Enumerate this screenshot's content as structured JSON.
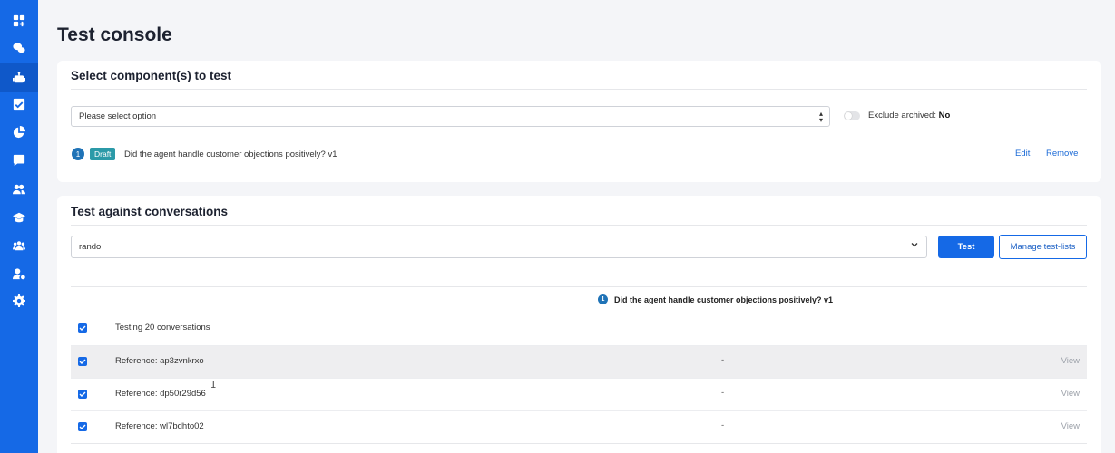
{
  "page": {
    "title": "Test console"
  },
  "sidebar": {
    "items": [
      {
        "icon": "dashboard-add-icon"
      },
      {
        "icon": "chat-bubbles-icon"
      },
      {
        "icon": "robot-icon",
        "active": true
      },
      {
        "icon": "checkbox-icon"
      },
      {
        "icon": "pie-chart-icon"
      },
      {
        "icon": "message-icon"
      },
      {
        "icon": "users-icon"
      },
      {
        "icon": "graduation-cap-icon"
      },
      {
        "icon": "team-icon"
      },
      {
        "icon": "user-settings-icon"
      },
      {
        "icon": "gear-icon"
      }
    ]
  },
  "components": {
    "title": "Select component(s) to test",
    "select_value": "Please select option",
    "exclude_label": "Exclude archived:",
    "exclude_value": "No",
    "selected": {
      "number": "1",
      "status": "Draft",
      "text": "Did the agent handle customer objections positively? v1",
      "edit_label": "Edit",
      "remove_label": "Remove"
    }
  },
  "conversations": {
    "title": "Test against conversations",
    "select_value": "rando",
    "test_button": "Test",
    "manage_button": "Manage test-lists",
    "column_number": "1",
    "column_header": "Did the agent handle customer objections positively? v1",
    "rows": [
      {
        "label": "Testing 20 conversations",
        "result": "",
        "action": "",
        "checked": true
      },
      {
        "label": "Reference: ap3zvnkrxo",
        "result": "-",
        "action": "View",
        "checked": true
      },
      {
        "label": "Reference: dp50r29d56",
        "result": "-",
        "action": "View",
        "checked": true
      },
      {
        "label": "Reference: wl7bdhto02",
        "result": "-",
        "action": "View",
        "checked": true
      }
    ]
  },
  "colors": {
    "accent": "#1569e6",
    "draft": "#2b9aa8",
    "link": "#1b6ad6"
  }
}
